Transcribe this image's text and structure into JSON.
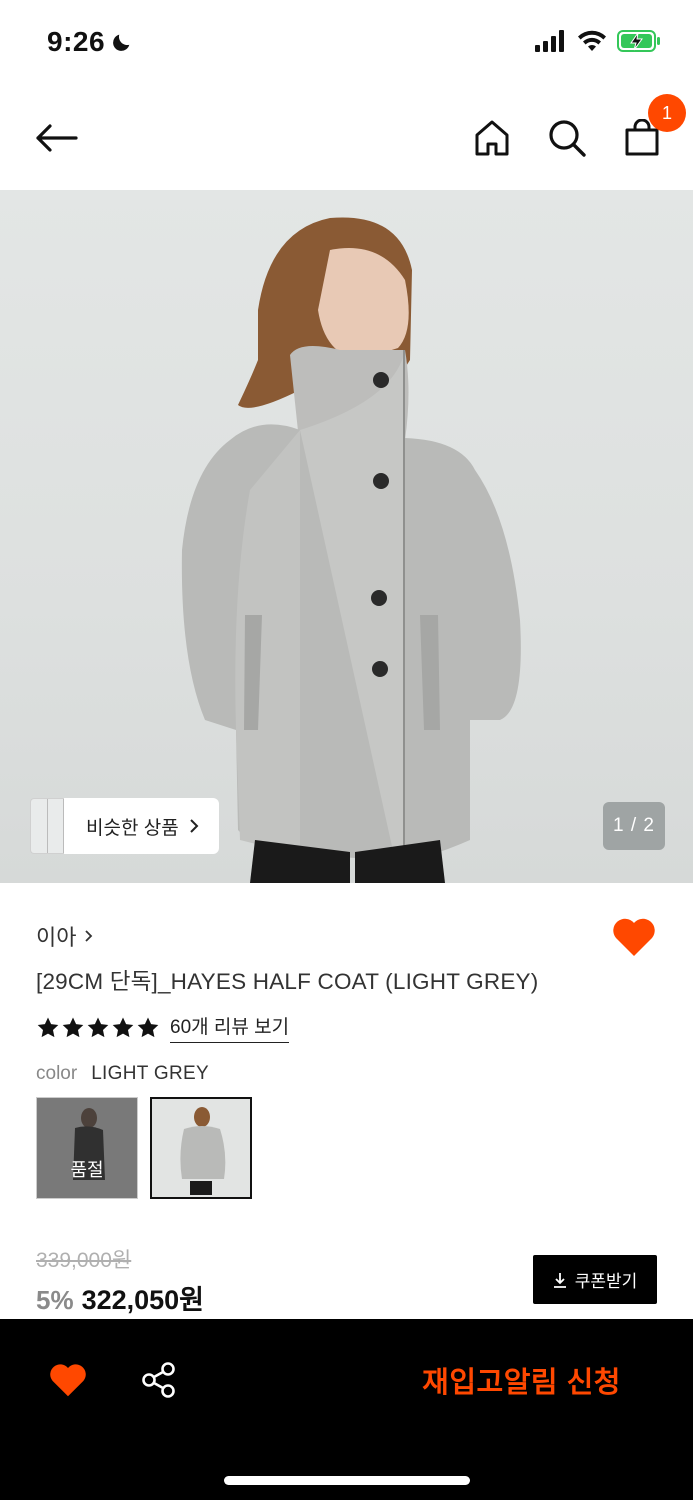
{
  "status_bar": {
    "time": "9:26"
  },
  "nav": {
    "cart_count": "1"
  },
  "hero": {
    "similar_label": "비슷한 상품",
    "page_indicator": "1 / 2"
  },
  "product": {
    "brand": "이아",
    "title": "[29CM 단독]_HAYES HALF COAT (LIGHT GREY)",
    "rating_stars": 5,
    "review_link": "60개 리뷰 보기",
    "color_label": "color",
    "color_value": "LIGHT GREY",
    "swatches": [
      {
        "badge": "품절"
      },
      {
        "badge": ""
      }
    ],
    "original_price": "339,000원",
    "discount": "5%",
    "price": "322,050원",
    "coupon_label": "쿠폰받기"
  },
  "bottom_bar": {
    "restock_label": "재입고알림 신청"
  },
  "colors": {
    "accent": "#ff4800",
    "black": "#000000"
  }
}
